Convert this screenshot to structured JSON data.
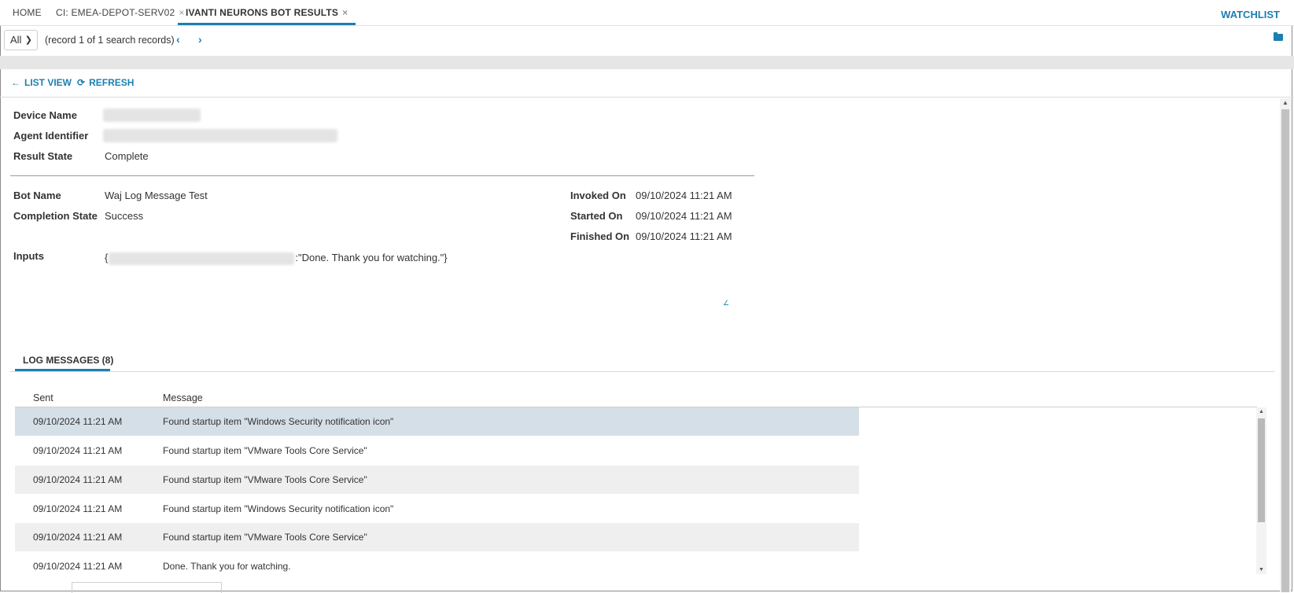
{
  "tabs": [
    {
      "label": "HOME",
      "closable": false
    },
    {
      "label": "CI: EMEA-DEPOT-SERV02",
      "closable": true
    },
    {
      "label": "IVANTI NEURONS BOT RESULTS",
      "closable": true,
      "active": true
    }
  ],
  "close_glyph": "×",
  "watchlist_label": "WATCHLIST",
  "record_bar": {
    "filter_value": "All",
    "record_text": "(record 1 of 1 search records)"
  },
  "actions": {
    "list_view": "LIST VIEW",
    "refresh": "REFRESH"
  },
  "details": {
    "device_name_label": "Device Name",
    "agent_identifier_label": "Agent Identifier",
    "result_state_label": "Result State",
    "result_state_value": "Complete",
    "bot_name_label": "Bot Name",
    "bot_name_value": "Waj Log Message Test",
    "completion_state_label": "Completion State",
    "completion_state_value": "Success",
    "inputs_label": "Inputs",
    "inputs_value_prefix": "{",
    "inputs_value_suffix": ":\"Done. Thank you for watching.\"}",
    "invoked_on_label": "Invoked On",
    "invoked_on_value": "09/10/2024 11:21 AM",
    "started_on_label": "Started On",
    "started_on_value": "09/10/2024 11:21 AM",
    "finished_on_label": "Finished On",
    "finished_on_value": "09/10/2024 11:21 AM"
  },
  "log_tab_label": "LOG MESSAGES (8)",
  "log_table": {
    "columns": [
      "Sent",
      "Message"
    ],
    "rows": [
      {
        "sent": "09/10/2024 11:21 AM",
        "message": "Found startup item \"Windows Security notification icon\""
      },
      {
        "sent": "09/10/2024 11:21 AM",
        "message": "Found startup item \"VMware Tools Core Service\""
      },
      {
        "sent": "09/10/2024 11:21 AM",
        "message": "Found startup item \"VMware Tools Core Service\""
      },
      {
        "sent": "09/10/2024 11:21 AM",
        "message": "Found startup item \"Windows Security notification icon\""
      },
      {
        "sent": "09/10/2024 11:21 AM",
        "message": "Found startup item \"VMware Tools Core Service\""
      },
      {
        "sent": "09/10/2024 11:21 AM",
        "message": "Done. Thank you for watching."
      }
    ]
  },
  "colors": {
    "accent": "#1c7fb0",
    "selected_row": "#d5dfe7",
    "alt_row": "#efefef"
  }
}
